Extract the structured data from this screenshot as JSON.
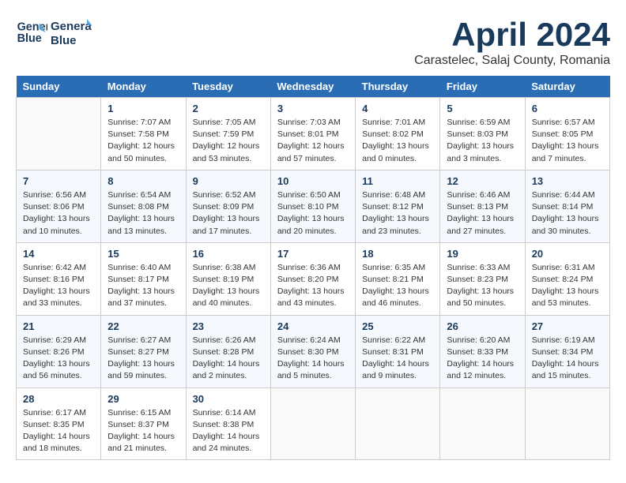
{
  "header": {
    "logo_line1": "General",
    "logo_line2": "Blue",
    "month_title": "April 2024",
    "subtitle": "Carastelec, Salaj County, Romania"
  },
  "weekdays": [
    "Sunday",
    "Monday",
    "Tuesday",
    "Wednesday",
    "Thursday",
    "Friday",
    "Saturday"
  ],
  "weeks": [
    [
      {
        "day": "",
        "sunrise": "",
        "sunset": "",
        "daylight": ""
      },
      {
        "day": "1",
        "sunrise": "Sunrise: 7:07 AM",
        "sunset": "Sunset: 7:58 PM",
        "daylight": "Daylight: 12 hours and 50 minutes."
      },
      {
        "day": "2",
        "sunrise": "Sunrise: 7:05 AM",
        "sunset": "Sunset: 7:59 PM",
        "daylight": "Daylight: 12 hours and 53 minutes."
      },
      {
        "day": "3",
        "sunrise": "Sunrise: 7:03 AM",
        "sunset": "Sunset: 8:01 PM",
        "daylight": "Daylight: 12 hours and 57 minutes."
      },
      {
        "day": "4",
        "sunrise": "Sunrise: 7:01 AM",
        "sunset": "Sunset: 8:02 PM",
        "daylight": "Daylight: 13 hours and 0 minutes."
      },
      {
        "day": "5",
        "sunrise": "Sunrise: 6:59 AM",
        "sunset": "Sunset: 8:03 PM",
        "daylight": "Daylight: 13 hours and 3 minutes."
      },
      {
        "day": "6",
        "sunrise": "Sunrise: 6:57 AM",
        "sunset": "Sunset: 8:05 PM",
        "daylight": "Daylight: 13 hours and 7 minutes."
      }
    ],
    [
      {
        "day": "7",
        "sunrise": "Sunrise: 6:56 AM",
        "sunset": "Sunset: 8:06 PM",
        "daylight": "Daylight: 13 hours and 10 minutes."
      },
      {
        "day": "8",
        "sunrise": "Sunrise: 6:54 AM",
        "sunset": "Sunset: 8:08 PM",
        "daylight": "Daylight: 13 hours and 13 minutes."
      },
      {
        "day": "9",
        "sunrise": "Sunrise: 6:52 AM",
        "sunset": "Sunset: 8:09 PM",
        "daylight": "Daylight: 13 hours and 17 minutes."
      },
      {
        "day": "10",
        "sunrise": "Sunrise: 6:50 AM",
        "sunset": "Sunset: 8:10 PM",
        "daylight": "Daylight: 13 hours and 20 minutes."
      },
      {
        "day": "11",
        "sunrise": "Sunrise: 6:48 AM",
        "sunset": "Sunset: 8:12 PM",
        "daylight": "Daylight: 13 hours and 23 minutes."
      },
      {
        "day": "12",
        "sunrise": "Sunrise: 6:46 AM",
        "sunset": "Sunset: 8:13 PM",
        "daylight": "Daylight: 13 hours and 27 minutes."
      },
      {
        "day": "13",
        "sunrise": "Sunrise: 6:44 AM",
        "sunset": "Sunset: 8:14 PM",
        "daylight": "Daylight: 13 hours and 30 minutes."
      }
    ],
    [
      {
        "day": "14",
        "sunrise": "Sunrise: 6:42 AM",
        "sunset": "Sunset: 8:16 PM",
        "daylight": "Daylight: 13 hours and 33 minutes."
      },
      {
        "day": "15",
        "sunrise": "Sunrise: 6:40 AM",
        "sunset": "Sunset: 8:17 PM",
        "daylight": "Daylight: 13 hours and 37 minutes."
      },
      {
        "day": "16",
        "sunrise": "Sunrise: 6:38 AM",
        "sunset": "Sunset: 8:19 PM",
        "daylight": "Daylight: 13 hours and 40 minutes."
      },
      {
        "day": "17",
        "sunrise": "Sunrise: 6:36 AM",
        "sunset": "Sunset: 8:20 PM",
        "daylight": "Daylight: 13 hours and 43 minutes."
      },
      {
        "day": "18",
        "sunrise": "Sunrise: 6:35 AM",
        "sunset": "Sunset: 8:21 PM",
        "daylight": "Daylight: 13 hours and 46 minutes."
      },
      {
        "day": "19",
        "sunrise": "Sunrise: 6:33 AM",
        "sunset": "Sunset: 8:23 PM",
        "daylight": "Daylight: 13 hours and 50 minutes."
      },
      {
        "day": "20",
        "sunrise": "Sunrise: 6:31 AM",
        "sunset": "Sunset: 8:24 PM",
        "daylight": "Daylight: 13 hours and 53 minutes."
      }
    ],
    [
      {
        "day": "21",
        "sunrise": "Sunrise: 6:29 AM",
        "sunset": "Sunset: 8:26 PM",
        "daylight": "Daylight: 13 hours and 56 minutes."
      },
      {
        "day": "22",
        "sunrise": "Sunrise: 6:27 AM",
        "sunset": "Sunset: 8:27 PM",
        "daylight": "Daylight: 13 hours and 59 minutes."
      },
      {
        "day": "23",
        "sunrise": "Sunrise: 6:26 AM",
        "sunset": "Sunset: 8:28 PM",
        "daylight": "Daylight: 14 hours and 2 minutes."
      },
      {
        "day": "24",
        "sunrise": "Sunrise: 6:24 AM",
        "sunset": "Sunset: 8:30 PM",
        "daylight": "Daylight: 14 hours and 5 minutes."
      },
      {
        "day": "25",
        "sunrise": "Sunrise: 6:22 AM",
        "sunset": "Sunset: 8:31 PM",
        "daylight": "Daylight: 14 hours and 9 minutes."
      },
      {
        "day": "26",
        "sunrise": "Sunrise: 6:20 AM",
        "sunset": "Sunset: 8:33 PM",
        "daylight": "Daylight: 14 hours and 12 minutes."
      },
      {
        "day": "27",
        "sunrise": "Sunrise: 6:19 AM",
        "sunset": "Sunset: 8:34 PM",
        "daylight": "Daylight: 14 hours and 15 minutes."
      }
    ],
    [
      {
        "day": "28",
        "sunrise": "Sunrise: 6:17 AM",
        "sunset": "Sunset: 8:35 PM",
        "daylight": "Daylight: 14 hours and 18 minutes."
      },
      {
        "day": "29",
        "sunrise": "Sunrise: 6:15 AM",
        "sunset": "Sunset: 8:37 PM",
        "daylight": "Daylight: 14 hours and 21 minutes."
      },
      {
        "day": "30",
        "sunrise": "Sunrise: 6:14 AM",
        "sunset": "Sunset: 8:38 PM",
        "daylight": "Daylight: 14 hours and 24 minutes."
      },
      {
        "day": "",
        "sunrise": "",
        "sunset": "",
        "daylight": ""
      },
      {
        "day": "",
        "sunrise": "",
        "sunset": "",
        "daylight": ""
      },
      {
        "day": "",
        "sunrise": "",
        "sunset": "",
        "daylight": ""
      },
      {
        "day": "",
        "sunrise": "",
        "sunset": "",
        "daylight": ""
      }
    ]
  ]
}
